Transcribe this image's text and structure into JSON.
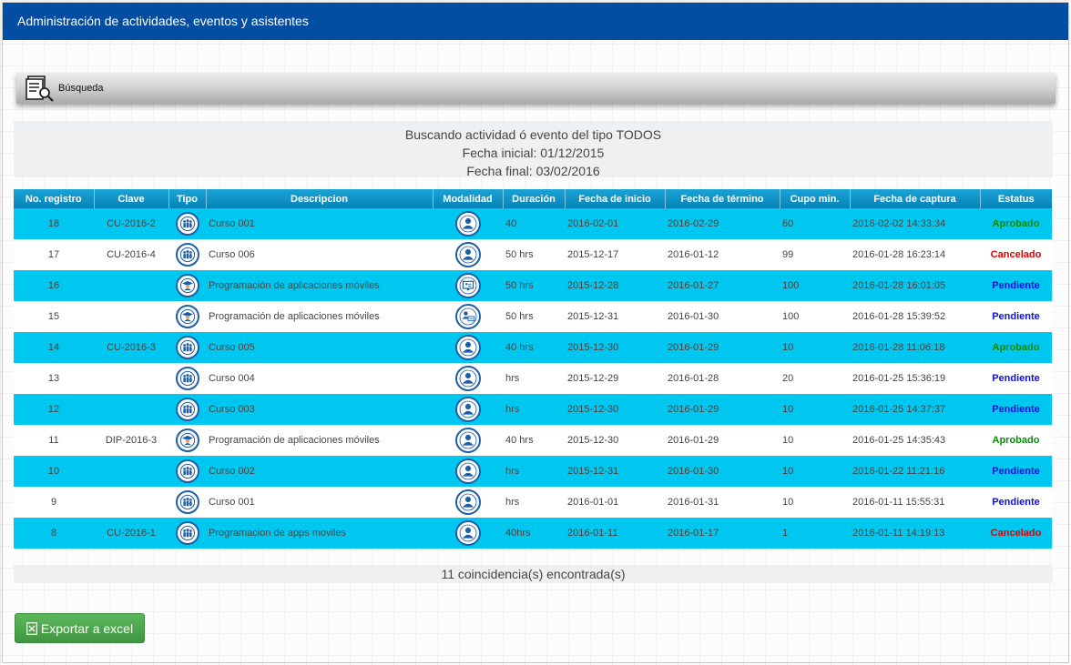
{
  "header": {
    "title": "Administración de actividades, eventos y asistentes"
  },
  "search": {
    "label": "Búsqueda",
    "icon": "search-document-icon"
  },
  "summary": {
    "line1": "Buscando actividad ó evento del tipo TODOS",
    "line2": "Fecha inicial: 01/12/2015",
    "line3": "Fecha final: 03/02/2016"
  },
  "table": {
    "headers": [
      "No. registro",
      "Clave",
      "Tipo",
      "Descripcion",
      "Modalidad",
      "Duración",
      "Fecha de inicio",
      "Fecha de término",
      "Cupo min.",
      "Fecha de captura",
      "Estatus"
    ],
    "rows": [
      {
        "no": "18",
        "clave": "CU-2016-2",
        "tipo": "course",
        "desc": "Curso 001",
        "modalidad": "presencial",
        "duracion": "40",
        "inicio": "2016-02-01",
        "termino": "2016-02-29",
        "cupo": "60",
        "captura": "2016-02-02 14:33:34",
        "estatus": "Aprobado"
      },
      {
        "no": "17",
        "clave": "CU-2016-4",
        "tipo": "course",
        "desc": "Curso 006",
        "modalidad": "presencial",
        "duracion": "50 hrs",
        "inicio": "2015-12-17",
        "termino": "2016-01-12",
        "cupo": "99",
        "captura": "2016-01-28 16:23:14",
        "estatus": "Cancelado"
      },
      {
        "no": "16",
        "clave": "",
        "tipo": "diploma",
        "desc": "Programación de aplicaciones móviles",
        "modalidad": "online",
        "duracion": "50 hrs",
        "inicio": "2015-12-28",
        "termino": "2016-01-27",
        "cupo": "100",
        "captura": "2016-01-28 16:01:05",
        "estatus": "Pendiente"
      },
      {
        "no": "15",
        "clave": "",
        "tipo": "diploma",
        "desc": "Programación de aplicaciones móviles",
        "modalidad": "mixed",
        "duracion": "50 hrs",
        "inicio": "2015-12-31",
        "termino": "2016-01-30",
        "cupo": "100",
        "captura": "2016-01-28 15:39:52",
        "estatus": "Pendiente"
      },
      {
        "no": "14",
        "clave": "CU-2016-3",
        "tipo": "course",
        "desc": "Curso 005",
        "modalidad": "presencial",
        "duracion": "40 hrs",
        "inicio": "2015-12-30",
        "termino": "2016-01-29",
        "cupo": "10",
        "captura": "2016-01-28 11:06:18",
        "estatus": "Aprobado"
      },
      {
        "no": "13",
        "clave": "",
        "tipo": "course",
        "desc": "Curso 004",
        "modalidad": "presencial",
        "duracion": "hrs",
        "inicio": "2015-12-29",
        "termino": "2016-01-28",
        "cupo": "20",
        "captura": "2016-01-25 15:36:19",
        "estatus": "Pendiente"
      },
      {
        "no": "12",
        "clave": "",
        "tipo": "course",
        "desc": "Curso 003",
        "modalidad": "presencial",
        "duracion": "hrs",
        "inicio": "2015-12-30",
        "termino": "2016-01-29",
        "cupo": "10",
        "captura": "2016-01-25 14:37:37",
        "estatus": "Pendiente"
      },
      {
        "no": "11",
        "clave": "DIP-2016-3",
        "tipo": "diploma",
        "desc": "Programación de aplicaciones móviles",
        "modalidad": "presencial",
        "duracion": "40 hrs",
        "inicio": "2015-12-30",
        "termino": "2016-01-29",
        "cupo": "10",
        "captura": "2016-01-25 14:35:43",
        "estatus": "Aprobado"
      },
      {
        "no": "10",
        "clave": "",
        "tipo": "course",
        "desc": "Curso 002",
        "modalidad": "presencial",
        "duracion": "hrs",
        "inicio": "2015-12-31",
        "termino": "2016-01-30",
        "cupo": "10",
        "captura": "2016-01-22 11:21:16",
        "estatus": "Pendiente"
      },
      {
        "no": "9",
        "clave": "",
        "tipo": "course",
        "desc": "Curso 001",
        "modalidad": "presencial",
        "duracion": "hrs",
        "inicio": "2016-01-01",
        "termino": "2016-01-31",
        "cupo": "10",
        "captura": "2016-01-11 15:55:31",
        "estatus": "Pendiente"
      },
      {
        "no": "8",
        "clave": "CU-2016-1",
        "tipo": "course",
        "desc": "Programacion de apps moviles",
        "modalidad": "presencial",
        "duracion": "40hrs",
        "inicio": "2016-01-11",
        "termino": "2016-01-17",
        "cupo": "1",
        "captura": "2016-01-11 14:19:13",
        "estatus": "Cancelado"
      }
    ]
  },
  "footer": {
    "count_text": "11 coincidencia(s) encontrada(s)"
  },
  "export": {
    "label": "Exportar a excel",
    "icon": "excel-file-icon"
  },
  "colors": {
    "header_bg": "#034ea2",
    "row_alt": "#00c7ef",
    "aprobado": "#0a8a0a",
    "cancelado": "#e00000",
    "pendiente": "#1010e0",
    "export_btn": "#5cb85c"
  }
}
